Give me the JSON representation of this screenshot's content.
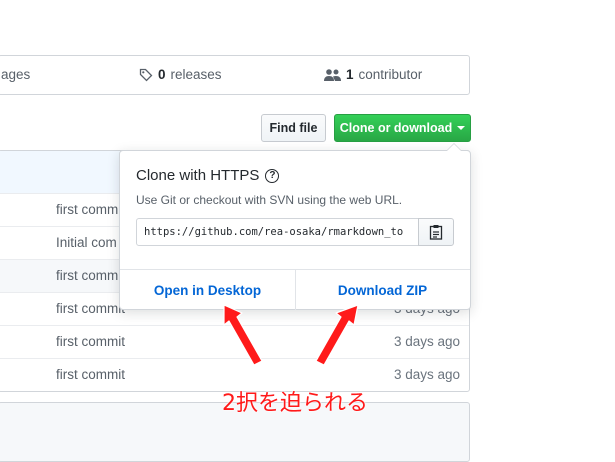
{
  "summary": {
    "packages_fragment": "ages",
    "releases_count": "0",
    "releases_label": "releases",
    "contributors_count": "1",
    "contributors_label": "contributor"
  },
  "toolbar": {
    "find_file_label": "Find file",
    "clone_label": "Clone or download"
  },
  "files": [
    {
      "message": "first commit",
      "age": ""
    },
    {
      "message": "Initial com",
      "age": ""
    },
    {
      "message": "first commit",
      "age": ""
    },
    {
      "message": "first commit",
      "age": "3 days ago"
    },
    {
      "message": "first commit",
      "age": "3 days ago"
    },
    {
      "message": "first commit",
      "age": "3 days ago"
    }
  ],
  "clone_panel": {
    "title": "Clone with HTTPS",
    "help_icon": "question-icon",
    "description": "Use Git or checkout with SVN using the web URL.",
    "url": "https://github.com/rea-osaka/rmarkdown_to",
    "clipboard_icon": "clipboard-icon",
    "open_desktop_label": "Open in Desktop",
    "download_zip_label": "Download ZIP"
  },
  "annotation": {
    "text": "2択を迫られる",
    "color": "#ff1a1a"
  },
  "colors": {
    "clone_button": "#28a745",
    "link": "#0366d6"
  }
}
